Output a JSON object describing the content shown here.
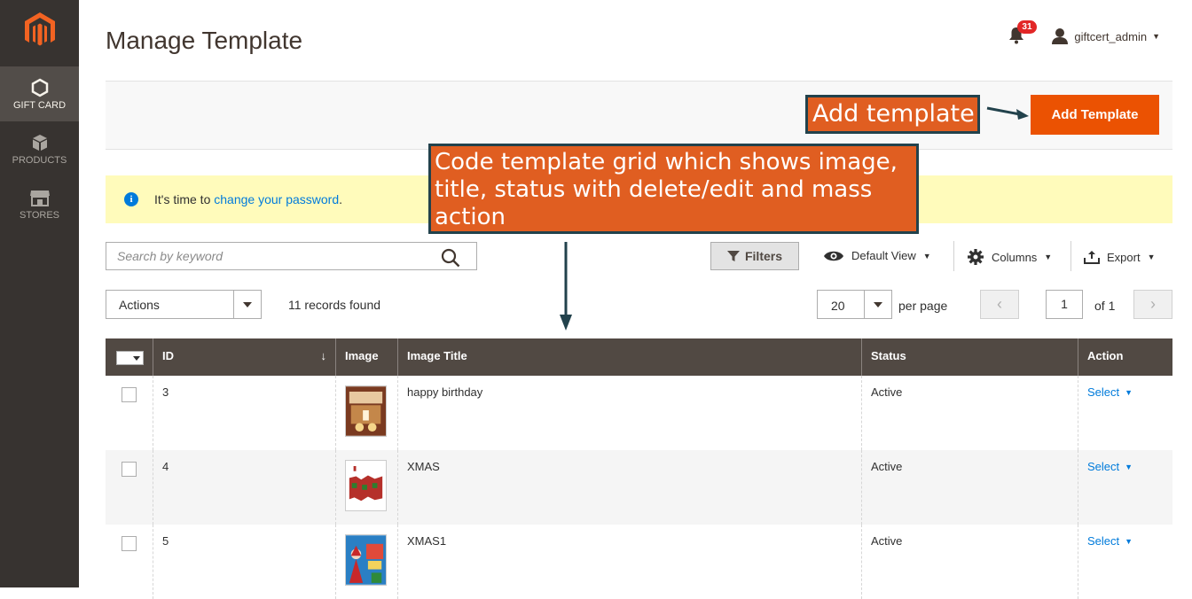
{
  "sidebar": {
    "items": [
      {
        "label": "GIFT CARD",
        "icon": "hexagon-icon",
        "active": true
      },
      {
        "label": "PRODUCTS",
        "icon": "box-icon",
        "active": false
      },
      {
        "label": "STORES",
        "icon": "storefront-icon",
        "active": false
      }
    ]
  },
  "header": {
    "title": "Manage Template",
    "notification_count": "31",
    "username": "giftcert_admin"
  },
  "toolbar": {
    "add_button": "Add Template"
  },
  "notice": {
    "prefix": "It's time to ",
    "link": "change your password",
    "suffix": "."
  },
  "search": {
    "placeholder": "Search by keyword"
  },
  "controls": {
    "filters": "Filters",
    "view": "Default View",
    "columns": "Columns",
    "export": "Export",
    "actions": "Actions",
    "records_found": "11 records found",
    "per_page_value": "20",
    "per_page_label": "per page",
    "page_value": "1",
    "page_of": "of 1",
    "prev": "‹",
    "next": "›"
  },
  "grid": {
    "columns": [
      "ID",
      "Image",
      "Image Title",
      "Status",
      "Action"
    ],
    "sort_indicator": "↓",
    "rows": [
      {
        "id": "3",
        "title": "happy birthday",
        "status": "Active",
        "action": "Select"
      },
      {
        "id": "4",
        "title": "XMAS",
        "status": "Active",
        "action": "Select"
      },
      {
        "id": "5",
        "title": "XMAS1",
        "status": "Active",
        "action": "Select"
      }
    ]
  },
  "annotations": {
    "add": "Add template",
    "grid": "Code template grid which shows image, title, status with delete/edit and mass action"
  },
  "colors": {
    "sidebar": "#373330",
    "accent": "#eb5202",
    "grid_header": "#514943",
    "link": "#007bdb",
    "callout": "#e05e21"
  }
}
